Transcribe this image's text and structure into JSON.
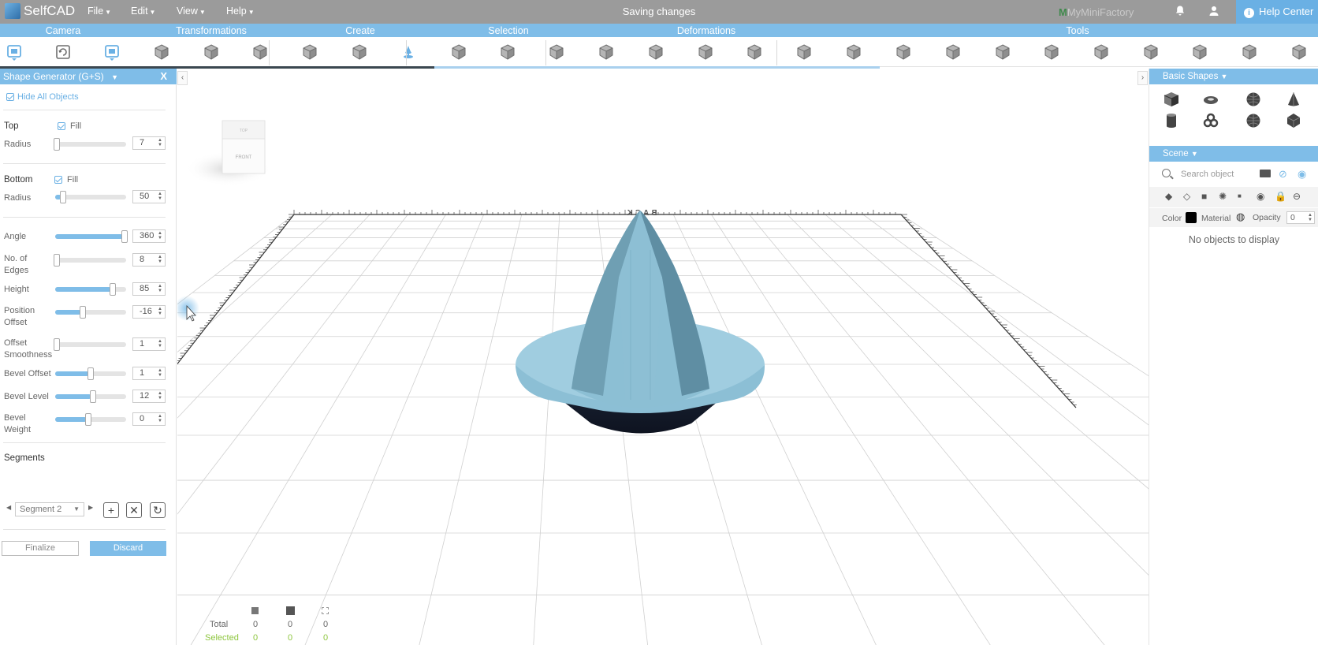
{
  "app": {
    "name": "SelfCAD",
    "status": "Saving changes",
    "brand_prefix": "M",
    "brand": "MyMiniFactory",
    "help": "Help Center",
    "help_icon": "info-icon"
  },
  "menu": [
    {
      "label": "File"
    },
    {
      "label": "Edit"
    },
    {
      "label": "View"
    },
    {
      "label": "Help"
    }
  ],
  "categories": [
    {
      "label": "Camera"
    },
    {
      "label": "Transformations"
    },
    {
      "label": "Create"
    },
    {
      "label": "Selection"
    },
    {
      "label": "Deformations"
    },
    {
      "label": "Tools"
    }
  ],
  "tools": [
    "camera-home-icon",
    "camera-rotate-icon",
    "camera-focus-icon",
    "move-icon",
    "scale-icon",
    "rotate-icon",
    "create-3d-text-icon",
    "create-shape-icon",
    "shape-generator-icon",
    "select-object-icon",
    "select-face-icon",
    "select-edge-icon",
    "extrude-icon",
    "bevel-icon",
    "taper-icon",
    "twist-icon",
    "bend-icon",
    "boolean-icon",
    "hollow-icon",
    "stitch-icon",
    "subdivide-icon",
    "simplify-icon",
    "array-icon",
    "mirror-icon",
    "slice-icon",
    "cut-icon",
    "sculpt-icon"
  ],
  "left_panel": {
    "title": "Shape Generator (G+S)",
    "close": "X",
    "hide_all": "Hide All Objects",
    "top_label": "Top",
    "top_fill": "Fill",
    "top_radius_label": "Radius",
    "top_radius": "7",
    "bottom_label": "Bottom",
    "bottom_fill": "Fill",
    "bottom_radius_label": "Radius",
    "bottom_radius": "50",
    "params": [
      {
        "label": "Angle",
        "value": "360",
        "level": 1.0
      },
      {
        "label": "No. of",
        "label2": "Edges",
        "value": "8",
        "level": 0.0
      },
      {
        "label": "Height",
        "value": "85",
        "level": 0.82
      },
      {
        "label": "Position",
        "label2": "Offset",
        "value": "-16",
        "level": 0.38
      },
      {
        "label": "Offset",
        "label2": "Smoothness",
        "value": "1",
        "level": 0.0
      },
      {
        "label": "Bevel Offset",
        "value": "1",
        "level": 0.5
      },
      {
        "label": "Bevel Level",
        "value": "12",
        "level": 0.53
      },
      {
        "label": "Bevel",
        "label2": "Weight",
        "value": "0",
        "level": 0.46
      }
    ],
    "segments_label": "Segments",
    "segment_value": "Segment 2",
    "finalize": "Finalize",
    "discard": "Discard"
  },
  "viewport": {
    "cube_top": "TOP",
    "cube_front": "FRONT",
    "back_label": "BACK",
    "stats": {
      "total_label": "Total",
      "selected_label": "Selected",
      "total": [
        "0",
        "0",
        "0"
      ],
      "selected": [
        "0",
        "0",
        "0"
      ]
    }
  },
  "right_panel": {
    "basic_shapes": "Basic Shapes",
    "shapes": [
      "cube-icon",
      "torus-icon",
      "sphere-icon",
      "cone-icon",
      "cylinder-icon",
      "torus-knot-icon",
      "geosphere-icon",
      "dodecahedron-icon"
    ],
    "scene": "Scene",
    "search_placeholder": "Search object",
    "color_label": "Color",
    "material_label": "Material",
    "opacity_label": "Opacity",
    "opacity_value": "0",
    "empty": "No objects to display"
  },
  "colors": {
    "accent": "#7fbde8",
    "topbar": "#9b9b9b",
    "shape_top": "#8fc0d6",
    "shape_bottom": "#0f1524"
  }
}
